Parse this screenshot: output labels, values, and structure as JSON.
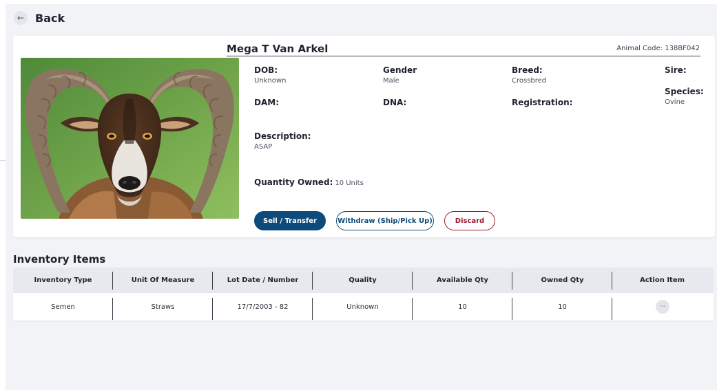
{
  "nav": {
    "back_label": "Back"
  },
  "animal": {
    "name": "Mega T Van Arkel",
    "code_label": "Animal Code:",
    "code": "138BF042",
    "fields": {
      "dob_label": "DOB:",
      "dob_value": "Unknown",
      "gender_label": "Gender",
      "gender_value": "Male",
      "breed_label": "Breed:",
      "breed_value": "Crossbred",
      "sire_label": "Sire:",
      "species_label": "Species:",
      "species_value": "Ovine",
      "dam_label": "DAM:",
      "dna_label": "DNA:",
      "registration_label": "Registration:",
      "description_label": "Description:",
      "description_value": "ASAP"
    },
    "quantity_label": "Quantity Owned:",
    "quantity_value": "10 Units"
  },
  "actions": {
    "sell_label": "Sell / Transfer",
    "withdraw_label": "Withdraw (Ship/Pick Up)",
    "discard_label": "Discard"
  },
  "inventory": {
    "title": "Inventory Items",
    "columns": [
      "Inventory Type",
      "Unit Of Measure",
      "Lot Date / Number",
      "Quality",
      "Available Qty",
      "Owned Qty",
      "Action Item"
    ],
    "rows": [
      [
        "Semen",
        "Straws",
        "17/7/2003 - 82",
        "Unknown",
        "10",
        "10"
      ]
    ],
    "action_icon": "ellipsis-icon",
    "action_glyph": "···"
  },
  "colors": {
    "primary": "#0e4a7a",
    "danger": "#a1162a",
    "background": "#f2f3f6"
  }
}
